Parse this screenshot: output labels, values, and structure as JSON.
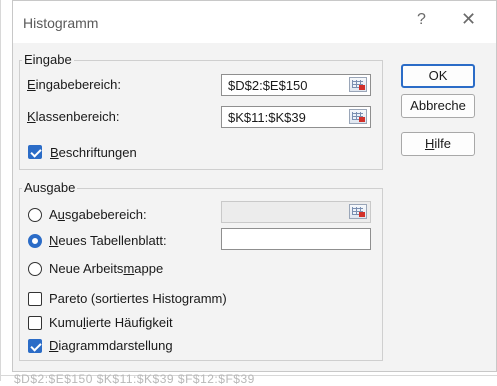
{
  "dialog": {
    "title": "Histogramm",
    "help_glyph": "?",
    "close_glyph": "✕"
  },
  "input_group": {
    "label": "Eingabe",
    "input_range": {
      "label_first": "E",
      "label_rest": "ingabebereich:",
      "value": "$D$2:$E$150"
    },
    "bin_range": {
      "label_first": "K",
      "label_rest": "lassenbereich:",
      "value": "$K$11:$K$39"
    },
    "labels_checkbox": {
      "label_first": "B",
      "label_rest": "eschriftungen",
      "checked": true
    }
  },
  "output_group": {
    "label": "Ausgabe",
    "output_range": {
      "label_a": "A",
      "label_u": "u",
      "label_rest": "sgabebereich:",
      "value": "",
      "selected": false
    },
    "new_sheet": {
      "label_first": "N",
      "label_rest": "eues Tabellenblatt:",
      "value": "",
      "selected": true
    },
    "new_workbook": {
      "label_a": "Neue Arbeits",
      "label_u": "m",
      "label_rest": "appe",
      "selected": false
    },
    "pareto": {
      "label": "Pareto (sortiertes Histogramm)",
      "checked": false
    },
    "cumulative": {
      "label_a": "Kumu",
      "label_u": "l",
      "label_rest": "ierte Häufigkeit",
      "checked": false
    },
    "chart_output": {
      "label_first": "D",
      "label_rest": "iagrammdarstellung",
      "checked": true
    }
  },
  "buttons": {
    "ok": "OK",
    "cancel": "Abbreche",
    "help_first": "H",
    "help_rest": "ilfe"
  },
  "background": {
    "partial_text": "$D$2:$E$150   $K$11:$K$39   $F$12:$F$39"
  },
  "colors": {
    "accent": "#2b6cc7",
    "dialog_bg": "#f3f3f3"
  },
  "icons": {
    "ref_button": "range-selector-icon",
    "help": "question-mark-icon",
    "close": "close-icon"
  }
}
